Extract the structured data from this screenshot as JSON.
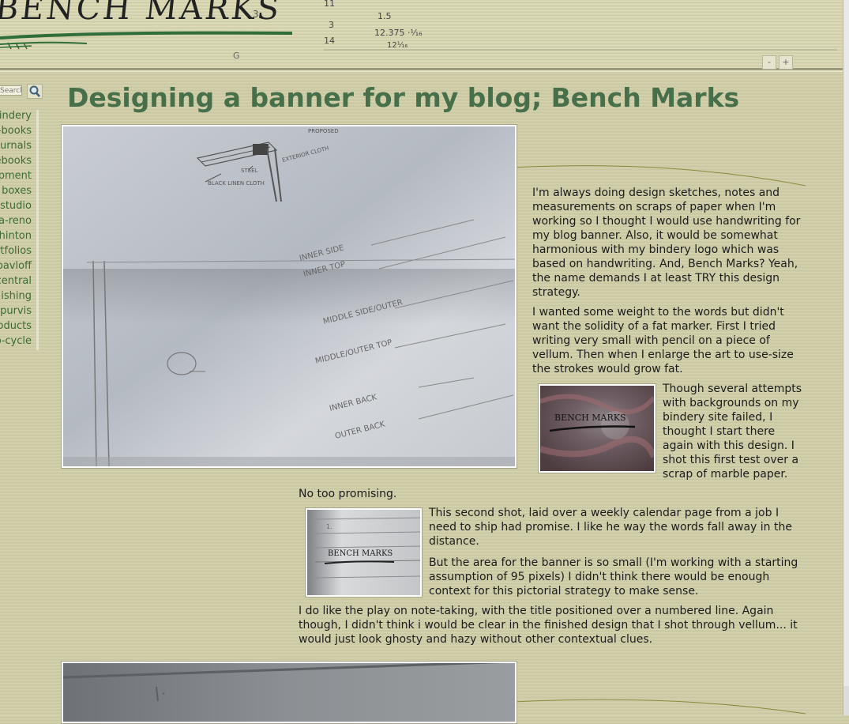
{
  "banner": {
    "logo_text": "BENCH MARKS",
    "zoom_out": "-",
    "zoom_in": "+"
  },
  "sidebar": {
    "search_placeholder": "Search",
    "items": [
      {
        "label": "bindery"
      },
      {
        "label": "e-books"
      },
      {
        "label": "journals"
      },
      {
        "label": "notebooks"
      },
      {
        "label": "equipment"
      },
      {
        "label": "boxes"
      },
      {
        "label": "studio"
      },
      {
        "label": "bella-reno"
      },
      {
        "label": "hinton"
      },
      {
        "label": "portfolios"
      },
      {
        "label": "pavloff"
      },
      {
        "label": "central"
      },
      {
        "label": "publishing"
      },
      {
        "label": "purvis"
      },
      {
        "label": "products"
      },
      {
        "label": "up-cycle"
      }
    ]
  },
  "post": {
    "title": "Designing a banner for my blog; Bench Marks",
    "p1": "I'm always doing design sketches, notes and measurements on scraps of paper when I'm working so I thought I would use handwriting for my blog banner. Also, it would be somewhat harmonious with my bindery logo which was based on handwriting. And, Bench Marks? Yeah, the name demands I at least TRY this design strategy.",
    "p2": "I wanted some weight to the words but didn't want the solidity of a fat marker. First I tried writing very small with pencil on a piece of vellum. Then when I enlarge the art to use-size the strokes would grow fat.",
    "p3": "Though several attempts with backgrounds on my bindery site failed, I thought I start there again with this design. I shot this first test over a scrap of marble paper.",
    "p4": "No too promising.",
    "p5": "This second shot, laid over a weekly calendar page from a job I need to ship had promise. I like he way the words fall away in the distance.",
    "p6": "But the area for the banner is so small (I'm working with a starting assumption of 95 pixels) I didn't think there would be enough context for this pictorial strategy to make sense.",
    "p7": "I do like the play on note-taking, with the title positioned over a numbered line. Again though, I didn't think i would be clear in the finished design that I shot through vellum... it would just look ghosty and hazy without other contextual clues.",
    "sketch_labels": [
      "BLACK LINEN CLOTH",
      "STEEL",
      "EXTERIOR CLOTH",
      "PROPOSED",
      "INNER SIDE",
      "INNER TOP",
      "MIDDLE SIDE/OUTER",
      "MIDDLE/OUTER TOP",
      "INNER BACK",
      "OUTER BACK"
    ],
    "thumb1_text": "BENCH MARKS",
    "thumb2_text": "BENCH MARKS",
    "thumb2_line": "1."
  },
  "colors": {
    "title_green": "#47704a",
    "nav_green": "#3e6a35",
    "background": "#cfcda6"
  }
}
